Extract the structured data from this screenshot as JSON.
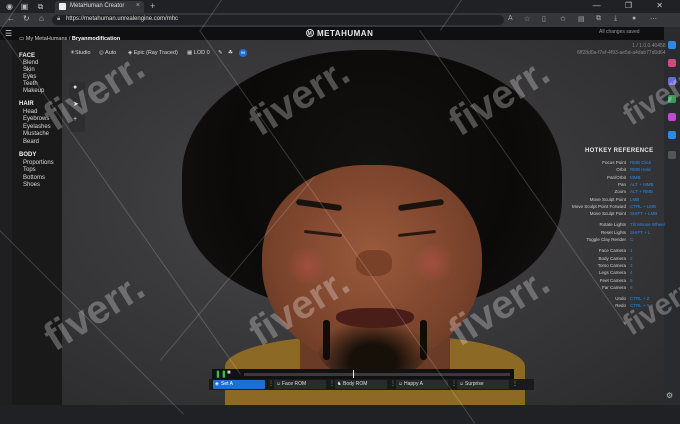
{
  "browser": {
    "tab_title": "MetaHuman Creator",
    "tab_close": "×",
    "new_tab": "+",
    "url": "https://metahuman.unrealengine.com/mhc",
    "window_controls": "— ❐ ✕"
  },
  "app": {
    "logo_text": "METAHUMAN",
    "changes_label": "All changes saved",
    "id_line_1": "1 / 1.0.0.40458",
    "id_line_2": "6ff28d0a-f7ef-4f93-ae5d-a4dab77d0d64"
  },
  "breadcrumb": {
    "root": "My MetaHumans",
    "separator": "/",
    "current": "Bryanmodification"
  },
  "toolbar": {
    "studio": "Studio",
    "auto": "Auto",
    "render": "Epic (Ray Traced)",
    "lod": "LOD 0",
    "badge": "99"
  },
  "sidebar": {
    "face": {
      "label": "FACE",
      "items": [
        "Blend",
        "Skin",
        "Eyes",
        "Teeth",
        "Makeup"
      ]
    },
    "hair": {
      "label": "HAIR",
      "items": [
        "Head",
        "Eyebrows",
        "Eyelashes",
        "Mustache",
        "Beard"
      ]
    },
    "body": {
      "label": "BODY",
      "items": [
        "Proportions",
        "Tops",
        "Bottoms",
        "Shoes"
      ]
    }
  },
  "hotkeys": {
    "title": "HOTKEY REFERENCE",
    "rows": [
      {
        "action": "Focus Point",
        "key": "RMB Click"
      },
      {
        "action": "Orbit",
        "key": "RMB Hold"
      },
      {
        "action": "Pan/Orbit",
        "key": "MMB"
      },
      {
        "action": "Pan",
        "key": "ALT + MMB"
      },
      {
        "action": "Zoom",
        "key": "ALT + RMB"
      },
      {
        "action": "Move Sculpt Point",
        "key": "LMB"
      },
      {
        "action": "Move Sculpt Point Forward",
        "key": "CTRL + LMB"
      },
      {
        "action": "Move Sculpt Point",
        "key": "SHIFT + LMB"
      },
      {
        "action": "Rotate Lights",
        "key": "Tilt Mouse Wheel"
      },
      {
        "action": "Reset Lights",
        "key": "SHIFT + L"
      },
      {
        "action": "Toggle Clay Render",
        "key": "C"
      },
      {
        "action": "Face Camera",
        "key": "1"
      },
      {
        "action": "Body Camera",
        "key": "2"
      },
      {
        "action": "Torso Camera",
        "key": "3"
      },
      {
        "action": "Legs Camera",
        "key": "4"
      },
      {
        "action": "Feet Camera",
        "key": "5"
      },
      {
        "action": "Far Camera",
        "key": "6"
      },
      {
        "action": "Undo",
        "key": "CTRL + Z"
      },
      {
        "action": "Redo",
        "key": "CTRL + Y"
      }
    ]
  },
  "presets": [
    {
      "label": "Set A",
      "active": true
    },
    {
      "label": "Face ROM",
      "active": false
    },
    {
      "label": "Body ROM",
      "active": false
    },
    {
      "label": "Happy A",
      "active": false
    },
    {
      "label": "Surprise",
      "active": false
    }
  ],
  "watermark": "fiverr.",
  "colors": {
    "accent": "#1d6fd6",
    "hotkey": "#2c89e8",
    "play": "#34c24a"
  }
}
